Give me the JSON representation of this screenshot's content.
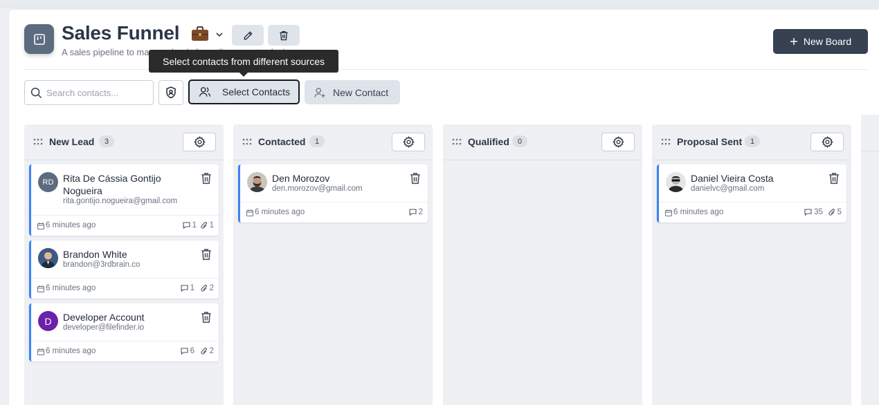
{
  "header": {
    "title": "Sales Funnel",
    "subtitle": "A sales pipeline to manage leads from discovery to closing",
    "new_board_label": "New Board"
  },
  "toolbar": {
    "search_placeholder": "Search contacts...",
    "select_contacts_label": "Select Contacts",
    "new_contact_label": "New Contact",
    "tooltip": "Select contacts from different sources"
  },
  "columns": [
    {
      "title": "New Lead",
      "count": "3",
      "cards": [
        {
          "name": "Rita De Cássia Gontijo Nogueira",
          "email": "rita.gontijo.nogueira@gmail.com",
          "initials": "RD",
          "time": "6 minutes ago",
          "comments": "1",
          "attachments": "1"
        },
        {
          "name": "Brandon White",
          "email": "brandon@3rdbrain.co",
          "initials": "",
          "time": "6 minutes ago",
          "comments": "1",
          "attachments": "2"
        },
        {
          "name": "Developer Account",
          "email": "developer@filefinder.io",
          "initials": "D",
          "time": "6 minutes ago",
          "comments": "6",
          "attachments": "2"
        }
      ]
    },
    {
      "title": "Contacted",
      "count": "1",
      "cards": [
        {
          "name": "Den Morozov",
          "email": "den.morozov@gmail.com",
          "initials": "",
          "time": "6 minutes ago",
          "comments": "2",
          "attachments": ""
        }
      ]
    },
    {
      "title": "Qualified",
      "count": "0",
      "cards": []
    },
    {
      "title": "Proposal Sent",
      "count": "1",
      "cards": [
        {
          "name": "Daniel Vieira Costa",
          "email": "danielvc@gmail.com",
          "initials": "",
          "time": "6 minutes ago",
          "comments": "35",
          "attachments": "5"
        }
      ]
    }
  ],
  "colors": {
    "accent": "#3b82f6",
    "primary_button": "#374151",
    "avatar_rd": "#5b6b80",
    "avatar_d": "#6b21a8"
  }
}
